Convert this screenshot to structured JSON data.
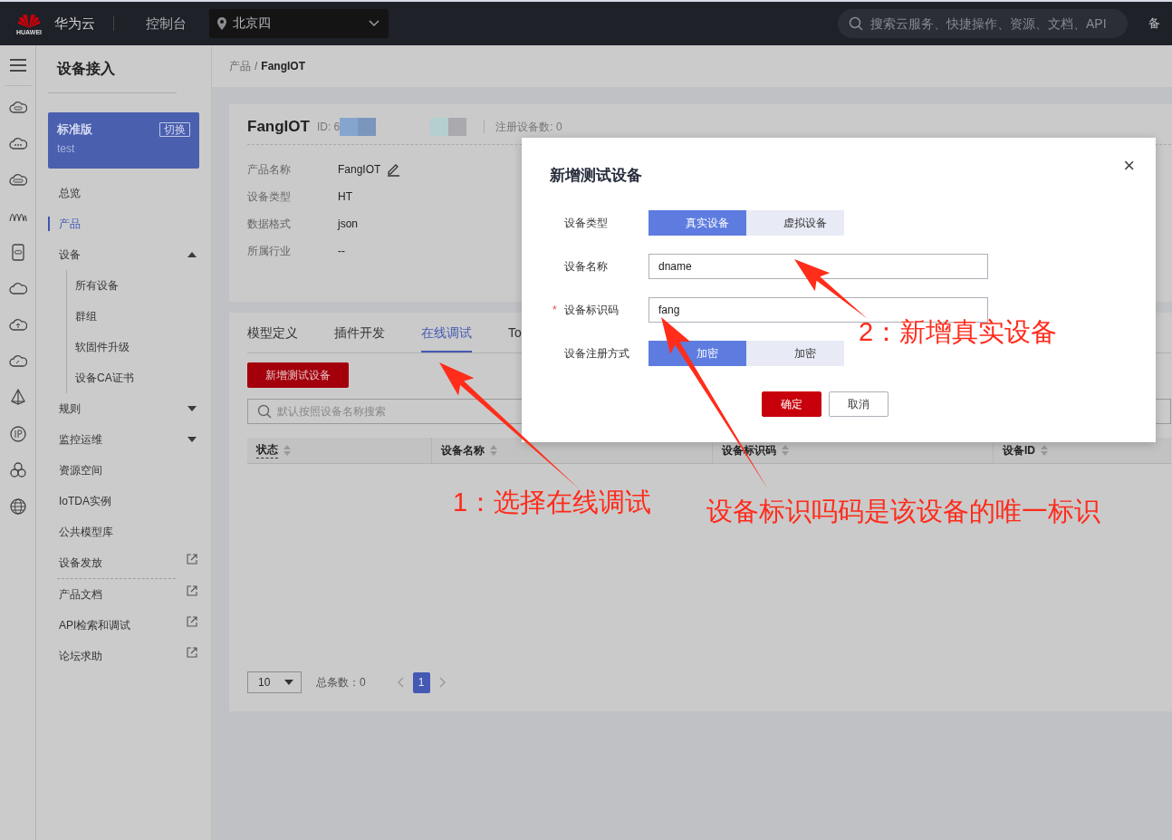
{
  "header": {
    "logo_text": "HUAWEI",
    "brand": "华为云",
    "console": "控制台",
    "region": "北京四",
    "search": {
      "placeholder": "搜索云服务、快捷操作、资源、文档、API"
    },
    "cut_link": "备"
  },
  "sidebar": {
    "title": "设备接入",
    "instance": {
      "edition": "标准版",
      "switch": "切换",
      "name": "test"
    },
    "items": [
      {
        "kind": "link",
        "label": "总览",
        "selected": false
      },
      {
        "kind": "link",
        "label": "产品",
        "selected": true
      },
      {
        "kind": "group",
        "label": "设备",
        "selected": false,
        "expanded": true,
        "children": [
          {
            "label": "所有设备",
            "selected": false
          },
          {
            "label": "群组",
            "selected": false
          },
          {
            "label": "软固件升级",
            "selected": false
          },
          {
            "label": "设备CA证书",
            "selected": false
          }
        ]
      },
      {
        "kind": "group",
        "label": "规则",
        "selected": false,
        "expanded": false
      },
      {
        "kind": "group",
        "label": "监控运维",
        "selected": false,
        "expanded": false
      },
      {
        "kind": "link",
        "label": "资源空间",
        "selected": false
      },
      {
        "kind": "link",
        "label": "IoTDA实例",
        "selected": false
      },
      {
        "kind": "link",
        "label": "公共模型库",
        "selected": false
      },
      {
        "kind": "external",
        "label": "设备发放",
        "selected": false
      },
      {
        "kind": "external",
        "label": "产品文档",
        "selected": false
      },
      {
        "kind": "external",
        "label": "API检索和调试",
        "selected": false
      },
      {
        "kind": "external",
        "label": "论坛求助",
        "selected": false
      }
    ]
  },
  "breadcrumb": {
    "separator": "/",
    "items": [
      {
        "label": "产品"
      },
      {
        "label": "FangIOT"
      }
    ]
  },
  "product": {
    "name": "FangIOT",
    "id_label": "ID: 6",
    "registered": "注册设备数: 0",
    "fields": [
      {
        "label": "产品名称",
        "value": "FangIOT",
        "editable": true
      },
      {
        "label": "设备类型",
        "value": "HT",
        "editable": false
      },
      {
        "label": "数据格式",
        "value": "json",
        "editable": false
      },
      {
        "label": "所属行业",
        "value": "--",
        "editable": false
      }
    ]
  },
  "tabs": [
    {
      "label": "模型定义",
      "selected": false
    },
    {
      "label": "插件开发",
      "selected": false
    },
    {
      "label": "在线调试",
      "selected": true
    },
    {
      "label": "To",
      "selected": false
    }
  ],
  "add_button": "新增测试设备",
  "table_search": {
    "placeholder": "默认按照设备名称搜索"
  },
  "table": {
    "columns": [
      "状态",
      "设备名称",
      "设备标识码",
      "设备ID"
    ]
  },
  "pagination": {
    "page_size": "10",
    "total": "总条数：0",
    "pages": [
      {
        "label": "1",
        "selected": true
      }
    ]
  },
  "dialog": {
    "title": "新增测试设备",
    "close": "×",
    "required_mark": "*",
    "rows": [
      {
        "kind": "segmented",
        "label": "设备类型",
        "required": false,
        "options": [
          {
            "label": "真实设备",
            "selected": true
          },
          {
            "label": "虚拟设备",
            "selected": false
          }
        ]
      },
      {
        "kind": "input",
        "label": "设备名称",
        "required": false,
        "value": "dname"
      },
      {
        "kind": "input",
        "label": "设备标识码",
        "required": true,
        "value": "fang"
      },
      {
        "kind": "segmented",
        "label": "设备注册方式",
        "required": false,
        "options": [
          {
            "label": "加密",
            "selected": true
          },
          {
            "label": "加密",
            "selected": false
          }
        ]
      }
    ],
    "buttons": [
      {
        "label": "确定",
        "kind": "primary"
      },
      {
        "label": "取消",
        "kind": "secondary"
      }
    ]
  },
  "annotations": [
    {
      "text": "1：选择在线调试"
    },
    {
      "text": "2：新增真实设备"
    },
    {
      "text": "设备标识吗码是该设备的唯一标识"
    }
  ]
}
